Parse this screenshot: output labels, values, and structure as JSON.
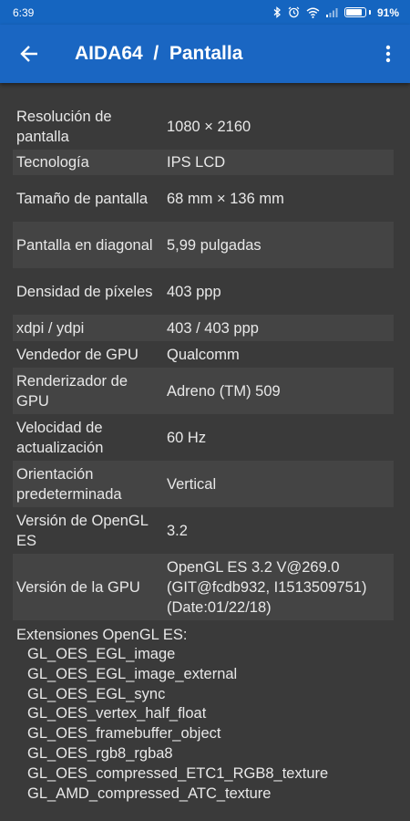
{
  "status_bar": {
    "time": "6:39",
    "battery_percent": "91%",
    "battery_level": 0.91,
    "icons": [
      "bluetooth-icon",
      "alarm-icon",
      "wifi-icon",
      "signal-icon",
      "battery-icon"
    ]
  },
  "app_bar": {
    "title": "AIDA64  /  Pantalla",
    "back_icon": "arrow-left-icon",
    "menu_icon": "more-vert-icon"
  },
  "rows": [
    {
      "label": "Resolución de pantalla",
      "value": "1080 × 2160"
    },
    {
      "label": "Tecnología",
      "value": "IPS LCD"
    },
    {
      "label": "Tamaño de pantalla",
      "value": "68 mm × 136 mm"
    },
    {
      "label": "Pantalla en diagonal",
      "value": "5,99 pulgadas"
    },
    {
      "label": "Densidad de píxeles",
      "value": "403 ppp"
    },
    {
      "label": "xdpi / ydpi",
      "value": "403 / 403 ppp"
    },
    {
      "label": "Vendedor de GPU",
      "value": "Qualcomm"
    },
    {
      "label": "Renderizador de GPU",
      "value": "Adreno (TM) 509"
    },
    {
      "label": "Velocidad de actualización",
      "value": "60 Hz"
    },
    {
      "label": "Orientación predeterminada",
      "value": "Vertical"
    },
    {
      "label": "Versión de OpenGL ES",
      "value": "3.2"
    },
    {
      "label": "Versión de la GPU",
      "value": "OpenGL ES 3.2 V@269.0 (GIT@fcdb932, I1513509751) (Date:01/22/18)"
    }
  ],
  "extensions": {
    "title": "Extensiones OpenGL ES:",
    "items": [
      "GL_OES_EGL_image",
      "GL_OES_EGL_image_external",
      "GL_OES_EGL_sync",
      "GL_OES_vertex_half_float",
      "GL_OES_framebuffer_object",
      "GL_OES_rgb8_rgba8",
      "GL_OES_compressed_ETC1_RGB8_texture",
      "GL_AMD_compressed_ATC_texture"
    ]
  },
  "colors": {
    "primary": "#1a66c2",
    "status_bar": "#1565c0",
    "background": "#3a3a3a",
    "row_alt": "#444444"
  }
}
